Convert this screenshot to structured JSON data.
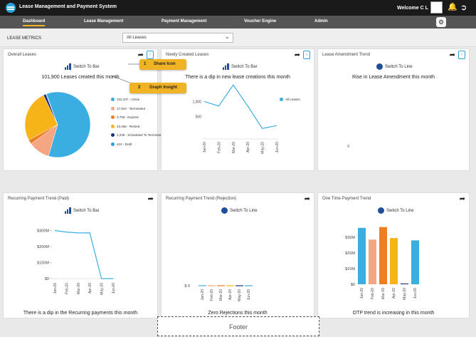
{
  "app": {
    "title": "Lease Management and Payment System",
    "welcome": "Welcome",
    "user": "C L"
  },
  "nav": {
    "tabs": [
      "Dashboard",
      "Lease Management",
      "Payment Management",
      "Voucher Engine",
      "Admin"
    ],
    "active": "Dashboard"
  },
  "metrics": {
    "label": "LEASE METRICS",
    "select_value": "All Leases"
  },
  "tooltips": [
    {
      "num": "1",
      "text": "Share Icon"
    },
    {
      "num": "2",
      "text": "Graph Insight"
    }
  ],
  "cards": {
    "overall": {
      "title": "Overall Leases",
      "switch": "Switch To Bar",
      "message": "101,900 Leases created this month"
    },
    "new": {
      "title": "Newly Created Leases",
      "switch": "Switch To Bar",
      "message": "There is a dip in new lease creations this month",
      "legend": "All Leases"
    },
    "amend": {
      "title": "Lease Amendment Trend",
      "switch": "Switch To Line",
      "message": "Rise in Lease Amendment this month"
    },
    "recurring": {
      "title": "Recurring Payment Trend (Paid)",
      "switch": "Switch To Bar",
      "message": "There is a dip in the Recurring payments this month"
    },
    "rejection": {
      "title": "Recurring Payment Trend (Rejection)",
      "switch": "Switch To Line",
      "message": "Zero Rejections this month"
    },
    "otp": {
      "title": "One Time Payment Trend",
      "switch": "Switch To Line",
      "message": "OTP trend is increasing in this month"
    }
  },
  "footer": "Footer",
  "colors": {
    "blue": "#3aaee0",
    "salmon": "#f4a582",
    "orange": "#ef7d22",
    "yellow": "#f6b418",
    "navy": "#1f2f7a",
    "accent": "#f0b323"
  },
  "chart_data": [
    {
      "type": "pie",
      "title": "Overall Leases",
      "slices": [
        {
          "label": "102,107 - Active",
          "value": 102107,
          "color": "#3aaee0"
        },
        {
          "label": "17,944 - Terminated",
          "value": 17944,
          "color": "#f4a582"
        },
        {
          "label": "3,709 - Expired",
          "value": 3709,
          "color": "#ef7d22"
        },
        {
          "label": "43,456 - Retired",
          "value": 43456,
          "color": "#f6b418"
        },
        {
          "label": "2,239 - Scheduled To Terminate",
          "value": 2239,
          "color": "#1f2f7a"
        },
        {
          "label": "424 - Draft",
          "value": 424,
          "color": "#2aa1d9"
        }
      ]
    },
    {
      "type": "line",
      "title": "Newly Created Leases",
      "categories": [
        "Jan-20",
        "Feb-20",
        "Mar-20",
        "Apr-20",
        "May-20",
        "Jun-20"
      ],
      "series": [
        {
          "name": "All Leases",
          "values": [
            1000,
            850,
            1550,
            850,
            100,
            200
          ]
        }
      ],
      "yticks": [
        "500",
        "1,000"
      ],
      "ylim": [
        -200,
        1700
      ]
    },
    {
      "type": "line",
      "title": "Lease Amendment Trend",
      "yticks": [
        "0"
      ],
      "series": [
        {
          "values": [
            0,
            0
          ]
        }
      ]
    },
    {
      "type": "line",
      "title": "Recurring Payment Trend (Paid)",
      "categories": [
        "Jan-20",
        "Feb-20",
        "Mar-20",
        "Apr-20",
        "May-20",
        "Jun-20"
      ],
      "series": [
        {
          "values": [
            300,
            290,
            285,
            285,
            0,
            0
          ]
        }
      ],
      "yticks": [
        "$0",
        "$100M",
        "$200M",
        "$300M"
      ],
      "ylim": [
        0,
        320
      ]
    },
    {
      "type": "bar",
      "title": "Recurring Payment Trend (Rejection)",
      "categories": [
        "Jan-20",
        "Feb-20",
        "Mar-20",
        "Apr-20",
        "May-20",
        "Jun-20"
      ],
      "values": [
        0,
        0,
        0,
        0,
        0,
        0
      ],
      "yticks": [
        "$ 0"
      ]
    },
    {
      "type": "bar",
      "title": "One Time Payment Trend",
      "categories": [
        "Jan-20",
        "Feb-20",
        "Mar-20",
        "Apr-20",
        "May-20",
        "Jun-20"
      ],
      "values": [
        36,
        28.5,
        36.5,
        29.5,
        0.5,
        28
      ],
      "colors": [
        "#3aaee0",
        "#f4a582",
        "#ef7d22",
        "#f6b418",
        "#1f2f7a",
        "#3aaee0"
      ],
      "yticks": [
        "$0",
        "$10M",
        "$20M",
        "$30M"
      ],
      "ylim": [
        0,
        40
      ]
    }
  ]
}
